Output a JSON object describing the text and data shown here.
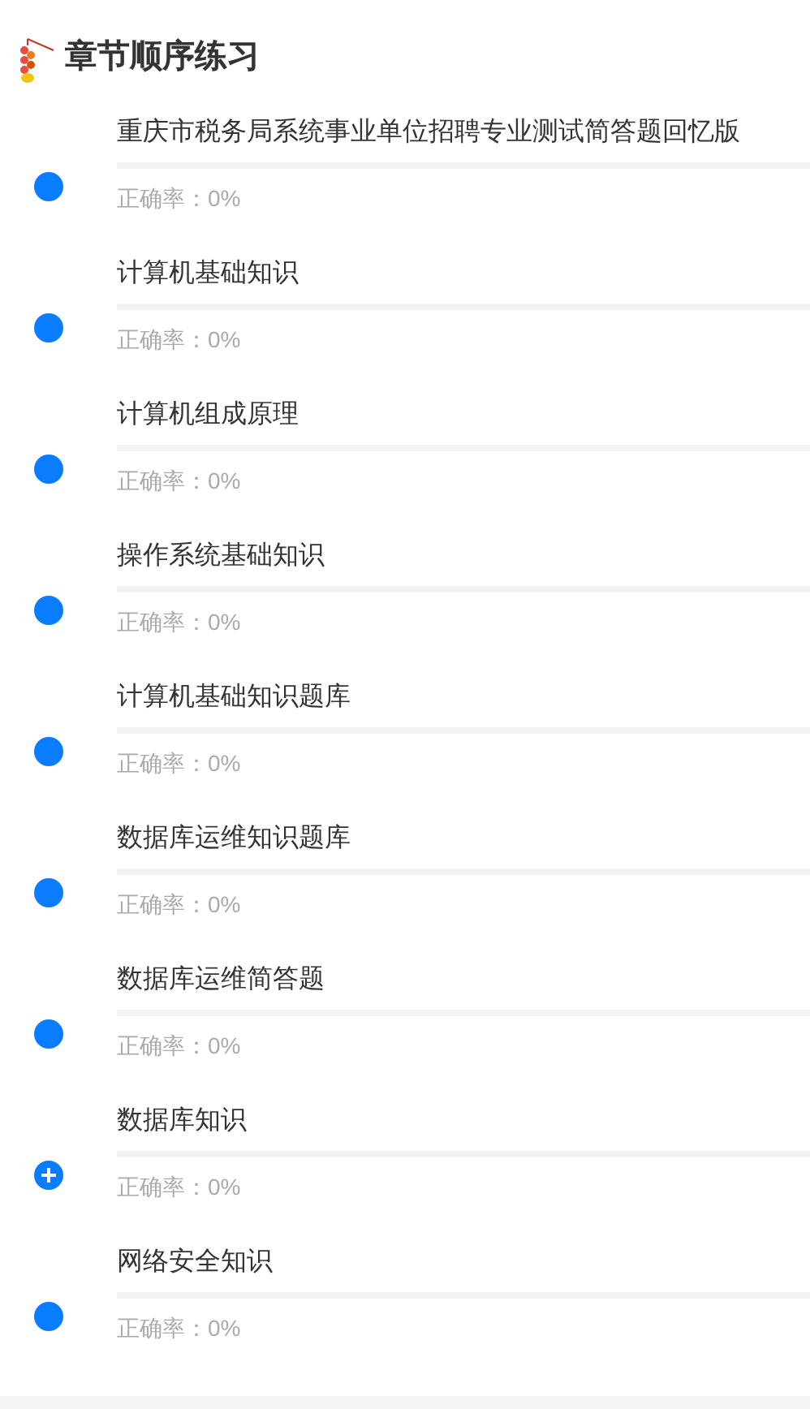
{
  "header": {
    "title": "章节顺序练习"
  },
  "chapters": [
    {
      "kind": "dot",
      "title": "重庆市税务局系统事业单位招聘专业测试简答题回忆版",
      "accuracy": "正确率：0%"
    },
    {
      "kind": "dot",
      "title": "计算机基础知识",
      "accuracy": "正确率：0%"
    },
    {
      "kind": "dot",
      "title": "计算机组成原理",
      "accuracy": "正确率：0%"
    },
    {
      "kind": "dot",
      "title": "操作系统基础知识",
      "accuracy": "正确率：0%"
    },
    {
      "kind": "dot",
      "title": "计算机基础知识题库",
      "accuracy": "正确率：0%"
    },
    {
      "kind": "dot",
      "title": "数据库运维知识题库",
      "accuracy": "正确率：0%"
    },
    {
      "kind": "dot",
      "title": "数据库运维简答题",
      "accuracy": "正确率：0%"
    },
    {
      "kind": "expand",
      "title": "数据库知识",
      "accuracy": "正确率：0%"
    },
    {
      "kind": "dot",
      "title": "网络安全知识",
      "accuracy": "正确率：0%"
    }
  ]
}
